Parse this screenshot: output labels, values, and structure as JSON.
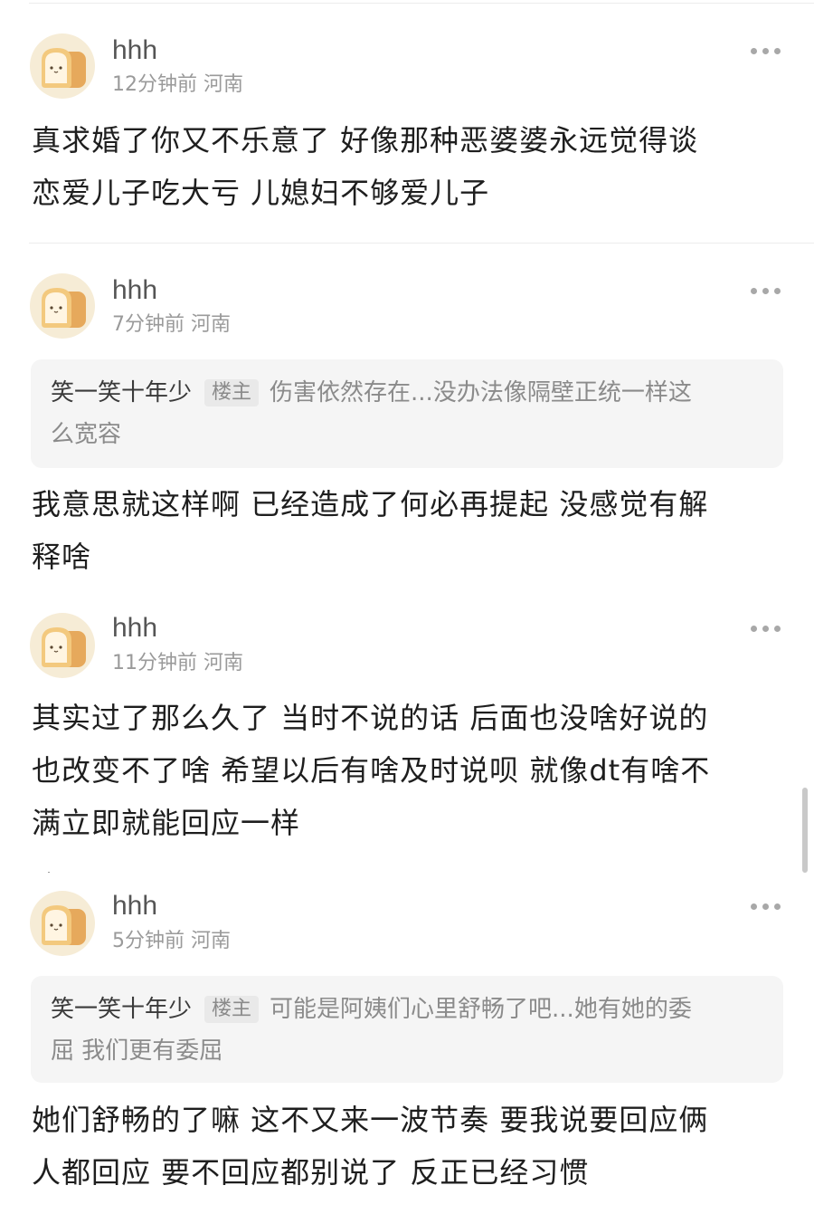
{
  "comments": [
    {
      "username": "hhh",
      "time": "12分钟前",
      "location": "河南",
      "content_lines": [
        "真求婚了你又不乐意了  好像那种恶婆婆永远觉得谈",
        "恋爱儿子吃大亏  儿媳妇不够爱儿子"
      ]
    },
    {
      "username": "hhh",
      "time": "7分钟前",
      "location": "河南",
      "quote": {
        "author": "笑一笑十年少",
        "badge": "楼主",
        "text_line1": "伤害依然存在...没办法像隔壁正统一样这",
        "text_line2": "么宽容"
      },
      "content_lines": [
        "我意思就这样啊  已经造成了何必再提起  没感觉有解",
        "释啥"
      ]
    },
    {
      "username": "hhh",
      "time": "11分钟前",
      "location": "河南",
      "content_lines": [
        "其实过了那么久了 当时不说的话 后面也没啥好说的",
        "也改变不了啥  希望以后有啥及时说呗  就像dt有啥不",
        "满立即就能回应一样"
      ]
    },
    {
      "username": "hhh",
      "time": "5分钟前",
      "location": "河南",
      "quote": {
        "author": "笑一笑十年少",
        "badge": "楼主",
        "text_line1": "可能是阿姨们心里舒畅了吧...她有她的委",
        "text_line2": "屈 我们更有委屈"
      },
      "content_lines": [
        "她们舒畅的了嘛  这不又来一波节奏  要我说要回应俩",
        "人都回应 要不回应都别说了  反正已经习惯"
      ]
    }
  ],
  "icons": {
    "avatar": "toast-bread-avatar",
    "more": "more-dots-icon"
  },
  "colors": {
    "avatar_bg": "#f6ecd6",
    "bread": "#f3c97e",
    "quote_bg": "#f5f5f5"
  }
}
